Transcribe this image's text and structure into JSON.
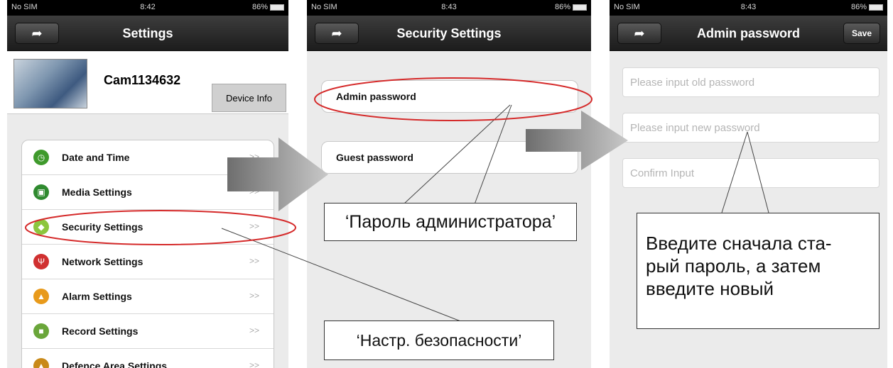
{
  "status_bars": [
    {
      "carrier": "No SIM",
      "time": "8:42",
      "battery": "86%"
    },
    {
      "carrier": "No SIM",
      "time": "8:43",
      "battery": "86%"
    },
    {
      "carrier": "No SIM",
      "time": "8:43",
      "battery": "86%"
    }
  ],
  "screen1": {
    "title": "Settings",
    "device_name": "Cam1134632",
    "device_info_label": "Device Info",
    "items": [
      {
        "label": "Date and Time",
        "icon": "clock-icon",
        "color": "#3f9a2c"
      },
      {
        "label": "Media Settings",
        "icon": "media-clapper-icon",
        "color": "#2f8a2f"
      },
      {
        "label": "Security Settings",
        "icon": "shield-icon",
        "color": "#8cc63e"
      },
      {
        "label": "Network Settings",
        "icon": "antenna-icon",
        "color": "#d03030"
      },
      {
        "label": "Alarm Settings",
        "icon": "bell-icon",
        "color": "#e89a1b"
      },
      {
        "label": "Record Settings",
        "icon": "camera-icon",
        "color": "#6aa63a"
      },
      {
        "label": "Defence Area Settings",
        "icon": "lock-icon",
        "color": "#c98a1a"
      }
    ],
    "chevron": ">>"
  },
  "screen2": {
    "title": "Security Settings",
    "rows": [
      {
        "label": "Admin password"
      },
      {
        "label": "Guest password"
      }
    ]
  },
  "screen3": {
    "title": "Admin password",
    "save_label": "Save",
    "inputs": [
      {
        "placeholder": "Please input old password",
        "value": ""
      },
      {
        "placeholder": "Please input new password",
        "value": ""
      },
      {
        "placeholder": "Confirm Input",
        "value": ""
      }
    ]
  },
  "annotations": {
    "callout_security": "‘Настр. безопасности’",
    "callout_admin": "‘Пароль администратора’",
    "callout_password": "Введите сначала старый пароль, а затем введите новый",
    "callout_password_lines": [
      "Введите сначала ста-",
      "рый пароль, а затем",
      "введите новый"
    ],
    "highlight_color": "#d52a2a",
    "arrow_color": "#8a8a8a"
  }
}
